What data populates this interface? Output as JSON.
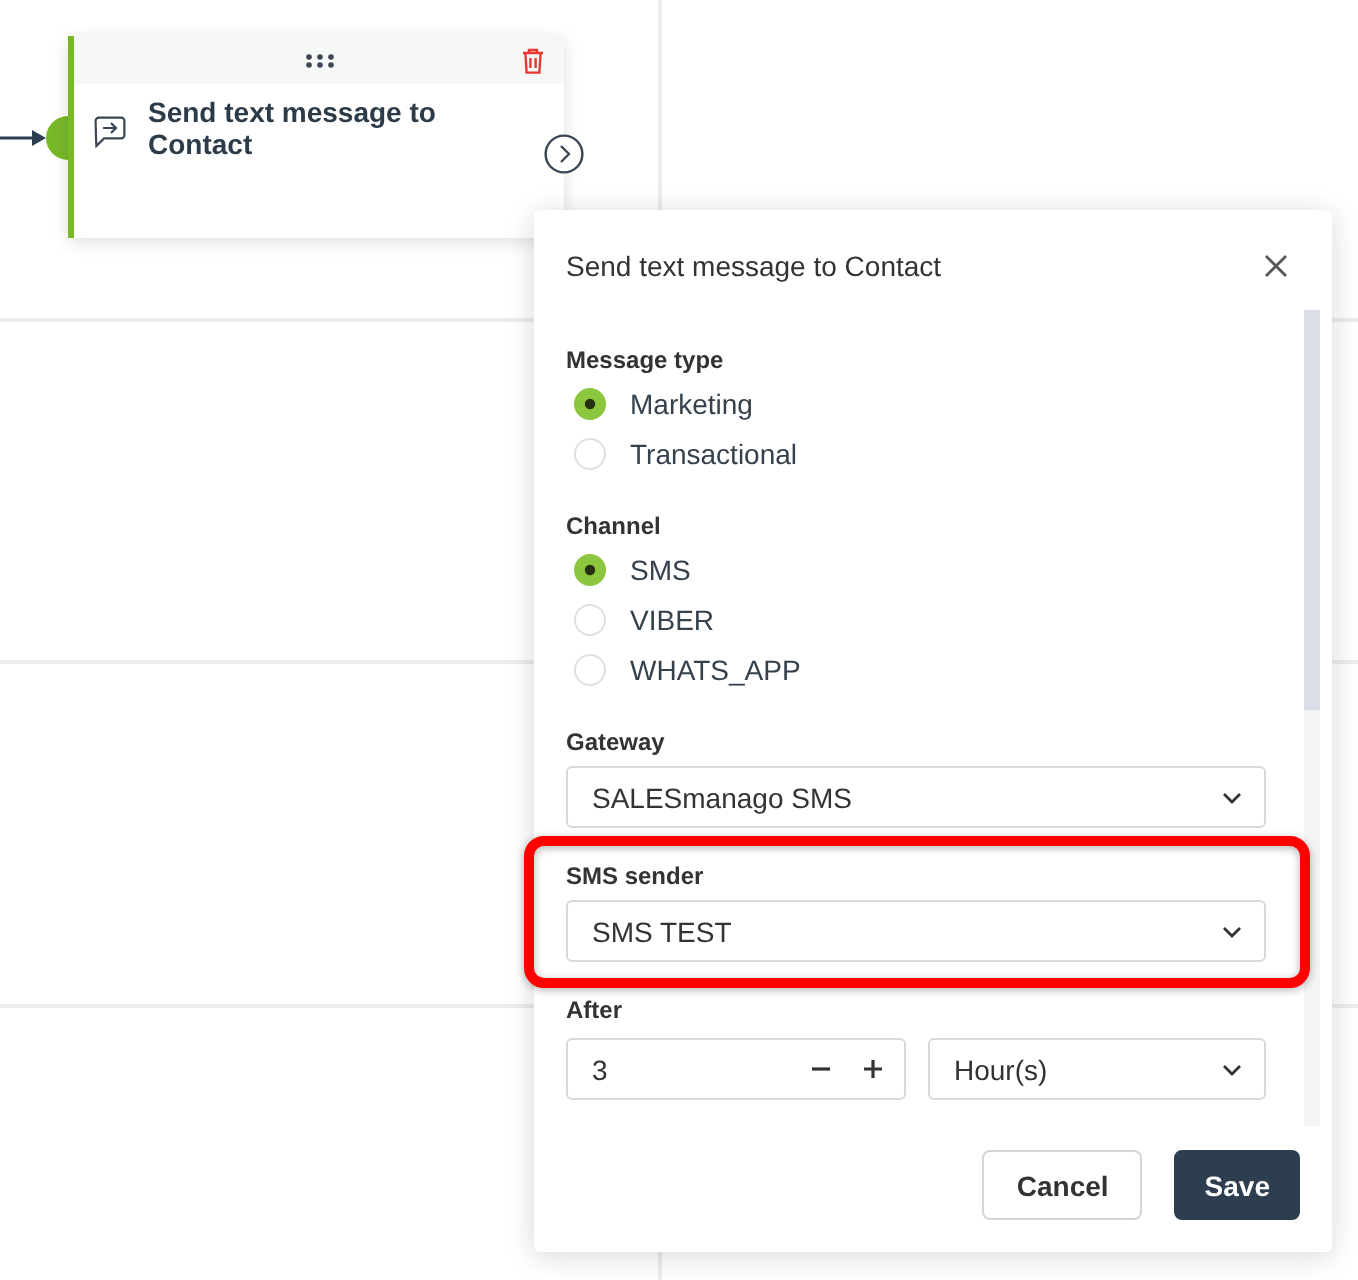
{
  "canvas": {
    "node": {
      "title": "Send text message to Contact"
    }
  },
  "panel": {
    "title": "Send text message to Contact",
    "sections": [
      {
        "kind": "radio",
        "label": "Message type",
        "highlighted": false,
        "options": [
          {
            "label": "Marketing",
            "selected": true
          },
          {
            "label": "Transactional",
            "selected": false
          }
        ]
      },
      {
        "kind": "radio",
        "label": "Channel",
        "highlighted": false,
        "options": [
          {
            "label": "SMS",
            "selected": true
          },
          {
            "label": "VIBER",
            "selected": false
          },
          {
            "label": "WHATS_APP",
            "selected": false
          }
        ]
      },
      {
        "kind": "select",
        "label": "Gateway",
        "highlighted": false,
        "value": "SALESmanago SMS"
      },
      {
        "kind": "select",
        "label": "SMS sender",
        "highlighted": true,
        "value": "SMS TEST"
      },
      {
        "kind": "delay",
        "label": "After",
        "highlighted": false,
        "value": "3",
        "unit": "Hour(s)"
      }
    ],
    "buttons": [
      {
        "kind": "secondary",
        "label": "Cancel"
      },
      {
        "kind": "primary",
        "label": "Save"
      }
    ]
  }
}
